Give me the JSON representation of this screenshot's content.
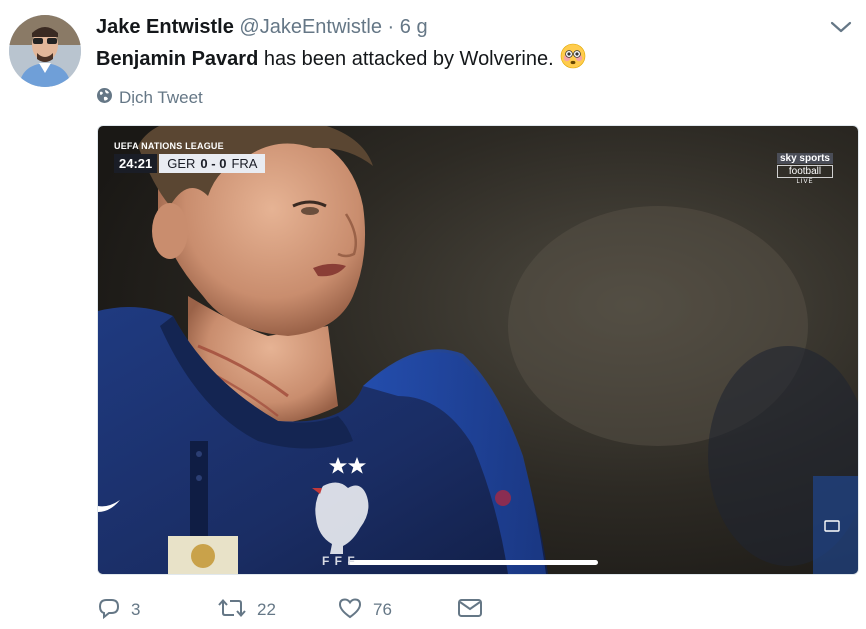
{
  "tweet": {
    "author_name": "Jake Entwistle",
    "author_handle": "@JakeEntwistle",
    "separator": "·",
    "time": "6 g",
    "text_bold": "Benjamin Pavard",
    "text_rest": " has been attacked by Wolverine.",
    "emoji_name": "flushed-face-emoji",
    "translate_label": "Dịch Tweet"
  },
  "media": {
    "competition": "UEFA NATIONS LEAGUE",
    "clock": "24:21",
    "home_team": "GER",
    "score": "0 - 0",
    "away_team": "FRA",
    "broadcaster_line1": "sky sports",
    "broadcaster_line2": "football",
    "broadcaster_line3": "LIVE",
    "shirt_text": "F F F"
  },
  "actions": {
    "replies": "3",
    "retweets": "22",
    "likes": "76"
  },
  "colors": {
    "text": "#14171a",
    "secondary": "#657786",
    "border": "#e1e8ed",
    "jersey": "#1b2f66"
  }
}
